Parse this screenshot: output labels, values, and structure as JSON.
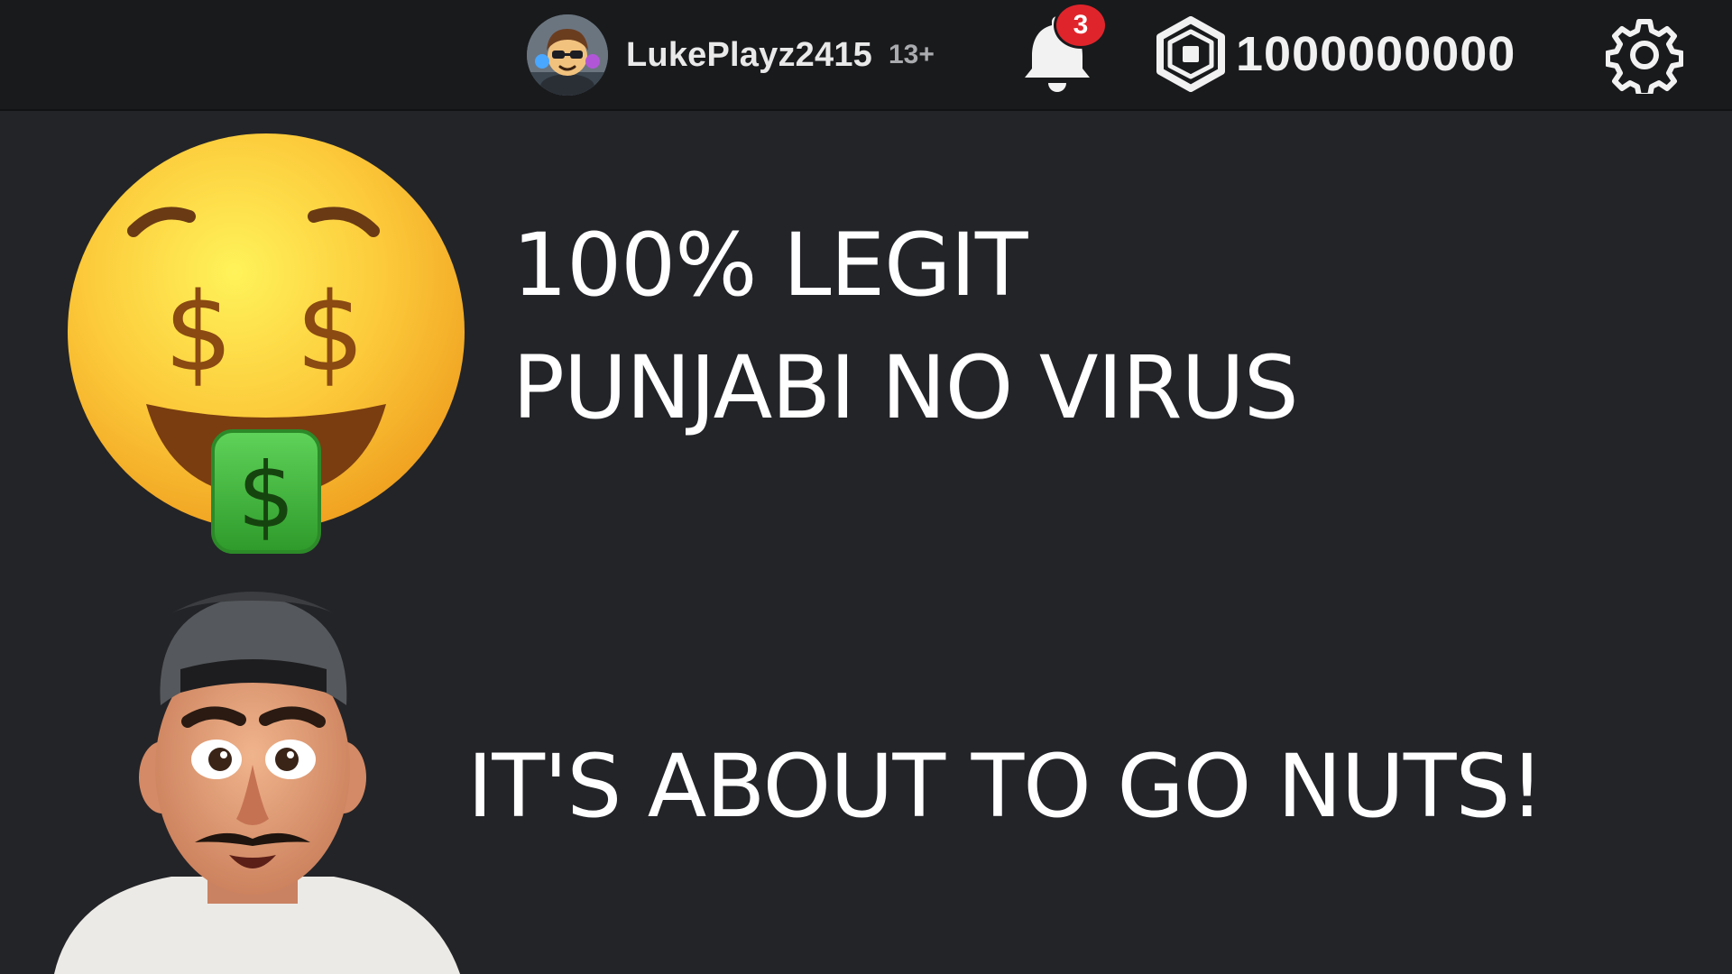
{
  "topbar": {
    "username": "LukePlayz2415",
    "age_label": "13+",
    "notification_count": "3",
    "robux_amount": "1000000000",
    "icons": {
      "avatar": "avatar-icon",
      "notifications": "bell-icon",
      "currency": "robux-icon",
      "settings": "gear-icon"
    }
  },
  "content": {
    "line1": "100% LEGIT",
    "line2": "PUNJABI NO VIRUS",
    "line3": "IT'S ABOUT TO GO NUTS!"
  },
  "colors": {
    "background": "#232428",
    "topbar": "#191a1c",
    "badge": "#e0242b",
    "text": "#ffffff"
  }
}
